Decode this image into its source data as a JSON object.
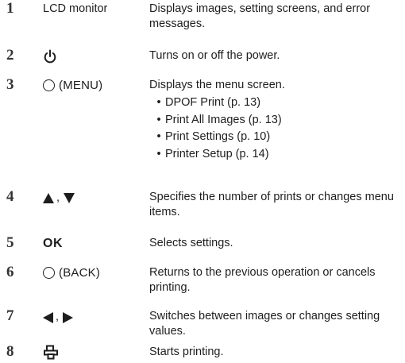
{
  "rows": [
    {
      "num": "1",
      "label": "LCD monitor",
      "icon": "text-label",
      "desc": "Displays images, setting screens, and error messages."
    },
    {
      "num": "2",
      "label": "",
      "icon": "power-icon",
      "desc": "Turns on or off the power."
    },
    {
      "num": "3",
      "label": "(MENU)",
      "icon": "circle-button-icon",
      "desc": "Displays the menu screen.",
      "bullets": [
        "DPOF Print (p. 13)",
        "Print All Images (p. 13)",
        "Print Settings (p. 10)",
        "Printer Setup (p. 14)"
      ]
    },
    {
      "num": "4",
      "label": ",",
      "icon": "up-down-triangle-icons",
      "desc": "Specifies the number of prints or changes menu items."
    },
    {
      "num": "5",
      "label": "OK",
      "icon": "ok-text",
      "desc": "Selects settings."
    },
    {
      "num": "6",
      "label": "(BACK)",
      "icon": "circle-button-icon",
      "desc": "Returns to the previous operation or cancels printing."
    },
    {
      "num": "7",
      "label": ",",
      "icon": "left-right-triangle-icons",
      "desc": "Switches between images or changes setting values."
    },
    {
      "num": "8",
      "label": "",
      "icon": "print-icon",
      "desc": "Starts printing."
    }
  ],
  "bullet_char": "•"
}
